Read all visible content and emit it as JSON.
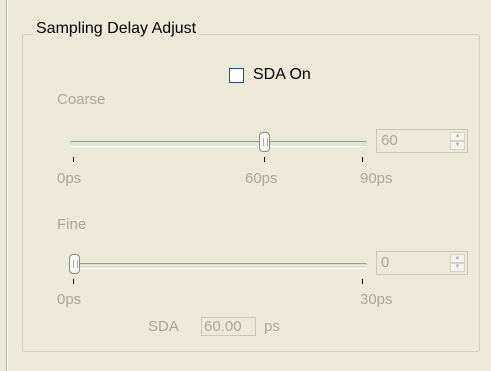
{
  "group": {
    "title": "Sampling Delay Adjust"
  },
  "sda_checkbox": {
    "label": "SDA On",
    "checked": false
  },
  "coarse": {
    "label": "Coarse",
    "value": "60",
    "ticks": [
      "0ps",
      "60ps",
      "90ps"
    ]
  },
  "fine": {
    "label": "Fine",
    "value": "0",
    "ticks": [
      "0ps",
      "30ps"
    ]
  },
  "sda": {
    "label": "SDA",
    "value": "60.00",
    "unit": "ps"
  },
  "colors": {
    "disabled_text": "#aca899",
    "background": "#ece9d8"
  }
}
